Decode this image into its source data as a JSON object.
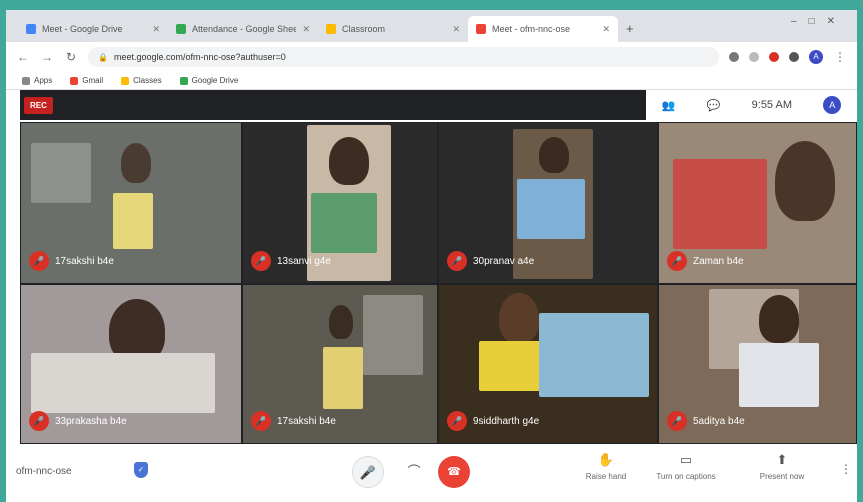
{
  "browser": {
    "tabs": [
      {
        "label": "Meet - Google Drive",
        "color": "#4285f4",
        "active": false
      },
      {
        "label": "Attendance - Google Sheets",
        "color": "#34a853",
        "active": false
      },
      {
        "label": "Classroom",
        "color": "#fbbc04",
        "active": false
      },
      {
        "label": "Meet - ofm-nnc-ose",
        "color": "#ea4335",
        "active": true
      }
    ],
    "new_tab": "+",
    "url": "meet.google.com/ofm-nnc-ose?authuser=0",
    "bookmarks": [
      {
        "label": "Apps",
        "color": "#888888"
      },
      {
        "label": "Gmail",
        "color": "#ea4335"
      },
      {
        "label": "Classes",
        "color": "#fbbc04"
      },
      {
        "label": "Google Drive",
        "color": "#34a853"
      }
    ]
  },
  "meet": {
    "rec_label": "REC",
    "time": "9:55 AM",
    "avatar_initial": "A",
    "participants": [
      {
        "name": "17sakshi b4e",
        "bg": "#6b6f6a"
      },
      {
        "name": "13sanvi g4e",
        "bg": "#8a7460"
      },
      {
        "name": "30pranav a4e",
        "bg": "#2a2a2a"
      },
      {
        "name": "Zaman b4e",
        "bg": "#9a8878"
      },
      {
        "name": "33prakasha b4e",
        "bg": "#a29a9a"
      },
      {
        "name": "17sakshi b4e",
        "bg": "#5d5a52"
      },
      {
        "name": "9siddharth g4e",
        "bg": "#3a2e1f"
      },
      {
        "name": "5aditya b4e",
        "bg": "#7d6a58"
      }
    ],
    "meeting_code": "ofm-nnc-ose",
    "actions": [
      {
        "label": "Raise hand",
        "icon": "✋"
      },
      {
        "label": "Turn on captions",
        "icon": "▭"
      },
      {
        "label": "Present now",
        "icon": "⬆"
      }
    ]
  }
}
